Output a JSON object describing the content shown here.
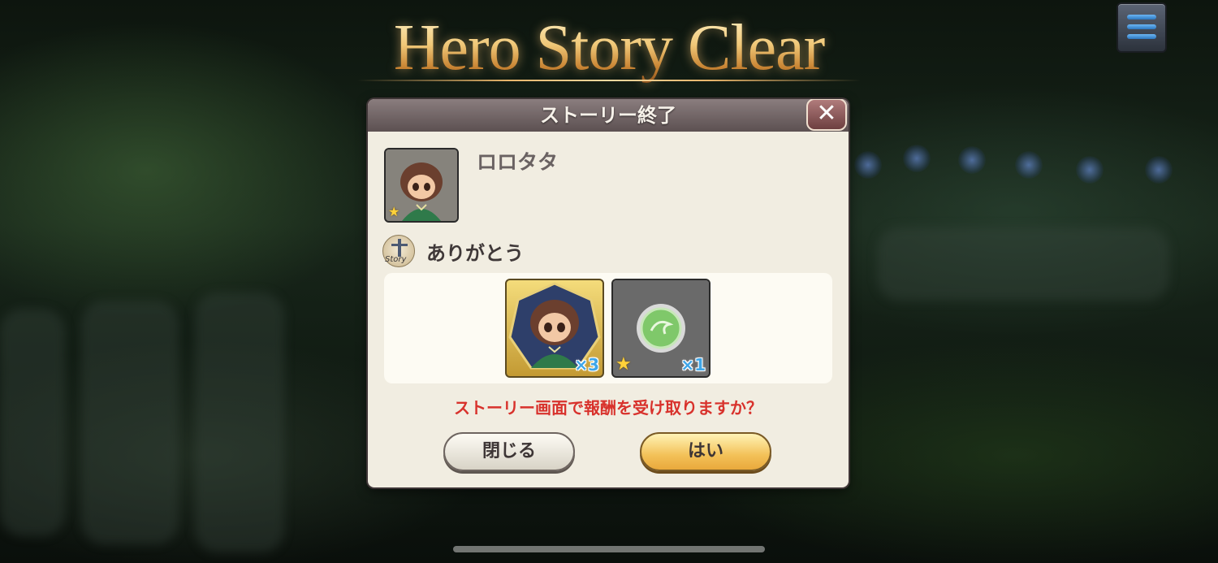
{
  "screen": {
    "title": "Hero Story Clear"
  },
  "menu": {
    "icon": "hamburger-menu-icon"
  },
  "dialog": {
    "header": "ストーリー終了",
    "close_icon": "close-icon",
    "character_name": "ロロタタ",
    "story_icon_label": "Story",
    "message": "ありがとう",
    "rewards": [
      {
        "type": "character-shard",
        "quantity_label": "×3",
        "rarity_star": false
      },
      {
        "type": "green-orb",
        "quantity_label": "×1",
        "rarity_star": true
      }
    ],
    "prompt": "ストーリー画面で報酬を受け取りますか？",
    "buttons": {
      "close_label": "閉じる",
      "yes_label": "はい"
    }
  },
  "colors": {
    "title_gold": "#f0c878",
    "prompt_red": "#d8322c",
    "dialog_bg": "#f1ede1",
    "yes_button": "#f3c158"
  }
}
